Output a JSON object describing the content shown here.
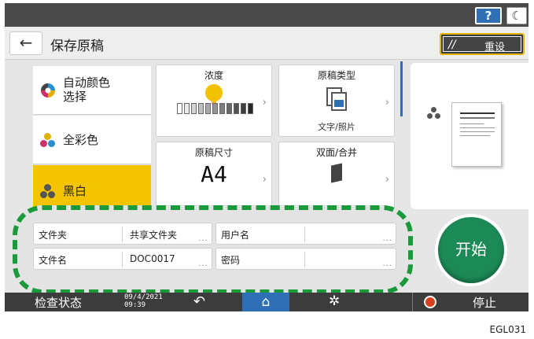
{
  "topbar": {
    "help_label": "?",
    "moon_icon": "☾"
  },
  "header": {
    "back_icon": "←",
    "title": "保存原稿",
    "reset_label": "重设",
    "reset_icon": "//"
  },
  "color_modes": [
    {
      "label": "自动颜色\n选择",
      "selected": false,
      "icon": "auto-color-icon"
    },
    {
      "label": "全彩色",
      "selected": false,
      "icon": "full-color-icon"
    },
    {
      "label": "黑白",
      "selected": true,
      "icon": "black-white-icon"
    }
  ],
  "tiles": {
    "density": {
      "title": "浓度",
      "level_fraction": 0.55
    },
    "original_type": {
      "title": "原稿类型",
      "value": "文字/照片"
    },
    "original_size": {
      "title": "原稿尺寸",
      "value": "A4"
    },
    "duplex": {
      "title": "双面/合并",
      "value": ""
    }
  },
  "fields": {
    "folder": {
      "label": "文件夹",
      "value": "共享文件夹"
    },
    "username": {
      "label": "用户名",
      "value": ""
    },
    "filename": {
      "label": "文件名",
      "value": "DOC0017"
    },
    "password": {
      "label": "密码",
      "value": ""
    },
    "more": "..."
  },
  "start_label": "开始",
  "status": {
    "check_label": "检查状态",
    "date": "09/4/2021",
    "time": "09:39",
    "home_icon": "⌂",
    "undo_icon": "↶",
    "gear_icon": "✲",
    "stop_label": "停止"
  },
  "colors": {
    "accent_yellow": "#f5c400",
    "start_green": "#1c8a56",
    "highlight_green": "#1a9a3a",
    "blue": "#2e6fb5"
  },
  "figure_id": "EGL031"
}
